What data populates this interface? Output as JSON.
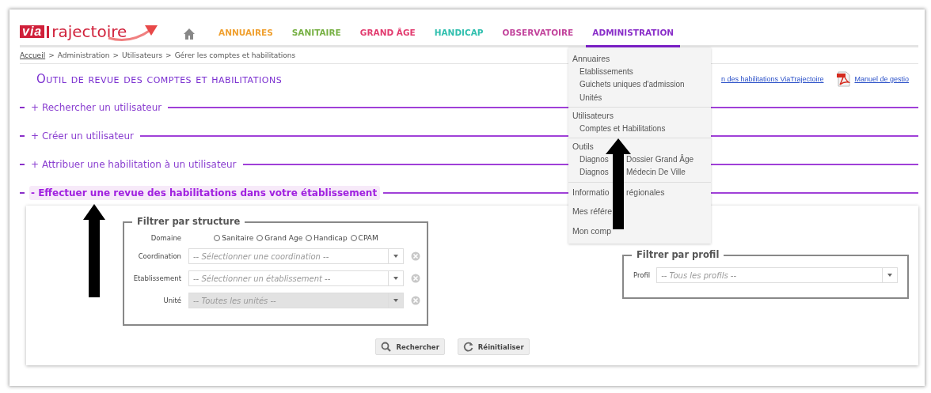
{
  "header": {
    "logo": {
      "mark": "via",
      "word": "rajectoire"
    },
    "nav": [
      {
        "label": "ANNUAIRES",
        "color": "#f0a030",
        "selected": false
      },
      {
        "label": "SANITAIRE",
        "color": "#76b043",
        "selected": false
      },
      {
        "label": "GRAND ÂGE",
        "color": "#e23a6e",
        "selected": false
      },
      {
        "label": "HANDICAP",
        "color": "#2fbfae",
        "selected": false
      },
      {
        "label": "OBSERVATOIRE",
        "color": "#c2449c",
        "selected": false
      },
      {
        "label": "ADMINISTRATION",
        "color": "#8a2fc9",
        "selected": true
      }
    ]
  },
  "breadcrumb": {
    "separator": ">",
    "items": [
      {
        "label": "Accueil",
        "link": true
      },
      {
        "label": "Administration",
        "link": false
      },
      {
        "label": "Utilisateurs",
        "link": false
      },
      {
        "label": "Gérer les comptes et habilitations",
        "link": false
      }
    ]
  },
  "title": "Outil de revue des comptes et habilitations",
  "links": [
    {
      "text": "n des habilitations ViaTrajectoire",
      "kind": "plain"
    },
    {
      "text": "Manuel de gestio",
      "kind": "pdf"
    }
  ],
  "sections": [
    {
      "toggle": "+",
      "label": "Rechercher un utilisateur",
      "expanded": false
    },
    {
      "toggle": "+",
      "label": "Créer un utilisateur",
      "expanded": false
    },
    {
      "toggle": "+",
      "label": "Attribuer une habilitation à un utilisateur",
      "expanded": false
    },
    {
      "toggle": "-",
      "label": "Effectuer une revue des habilitations dans votre établissement",
      "expanded": true
    }
  ],
  "structure_filter": {
    "legend": "Filtrer par structure",
    "domain": {
      "label": "Domaine",
      "options": [
        {
          "label": "Sanitaire",
          "selected": false
        },
        {
          "label": "Grand Age",
          "selected": false
        },
        {
          "label": "Handicap",
          "selected": false
        },
        {
          "label": "CPAM",
          "selected": false
        }
      ]
    },
    "selects": [
      {
        "label": "Coordination",
        "placeholder": "-- Sélectionner une coordination --",
        "disabled": false
      },
      {
        "label": "Etablissement",
        "placeholder": "-- Sélectionner un établissement --",
        "disabled": false
      },
      {
        "label": "Unité",
        "placeholder": "-- Toutes les unités --",
        "disabled": true
      }
    ]
  },
  "profile_filter": {
    "legend": "Filtrer par profil",
    "label": "Profil",
    "placeholder": "-- Tous les profils --"
  },
  "buttons": [
    {
      "label": "Rechercher",
      "kind": "search"
    },
    {
      "label": "Réinitialiser",
      "kind": "reset"
    }
  ],
  "menu": [
    {
      "label": [
        "Annuaires"
      ],
      "children": [
        {
          "label": [
            "Etablissements"
          ]
        },
        {
          "label": [
            "Guichets uniques d'admission"
          ]
        },
        {
          "label": [
            "Unités"
          ]
        }
      ]
    },
    {
      "label": [
        "Utilisateurs"
      ],
      "children": [
        {
          "label": [
            "Comptes et Habilitations"
          ]
        }
      ]
    },
    {
      "label": [
        "Outils"
      ],
      "children": [
        {
          "label": [
            "Diagnos",
            "Dossier Grand Âge"
          ]
        },
        {
          "label": [
            "Diagnos",
            "Médecin De Ville"
          ]
        }
      ]
    },
    {
      "label": [
        "Informatio",
        "régionales"
      ]
    },
    {
      "label": [
        "Mes référe"
      ]
    },
    {
      "label": [
        "Mon comp"
      ]
    }
  ]
}
